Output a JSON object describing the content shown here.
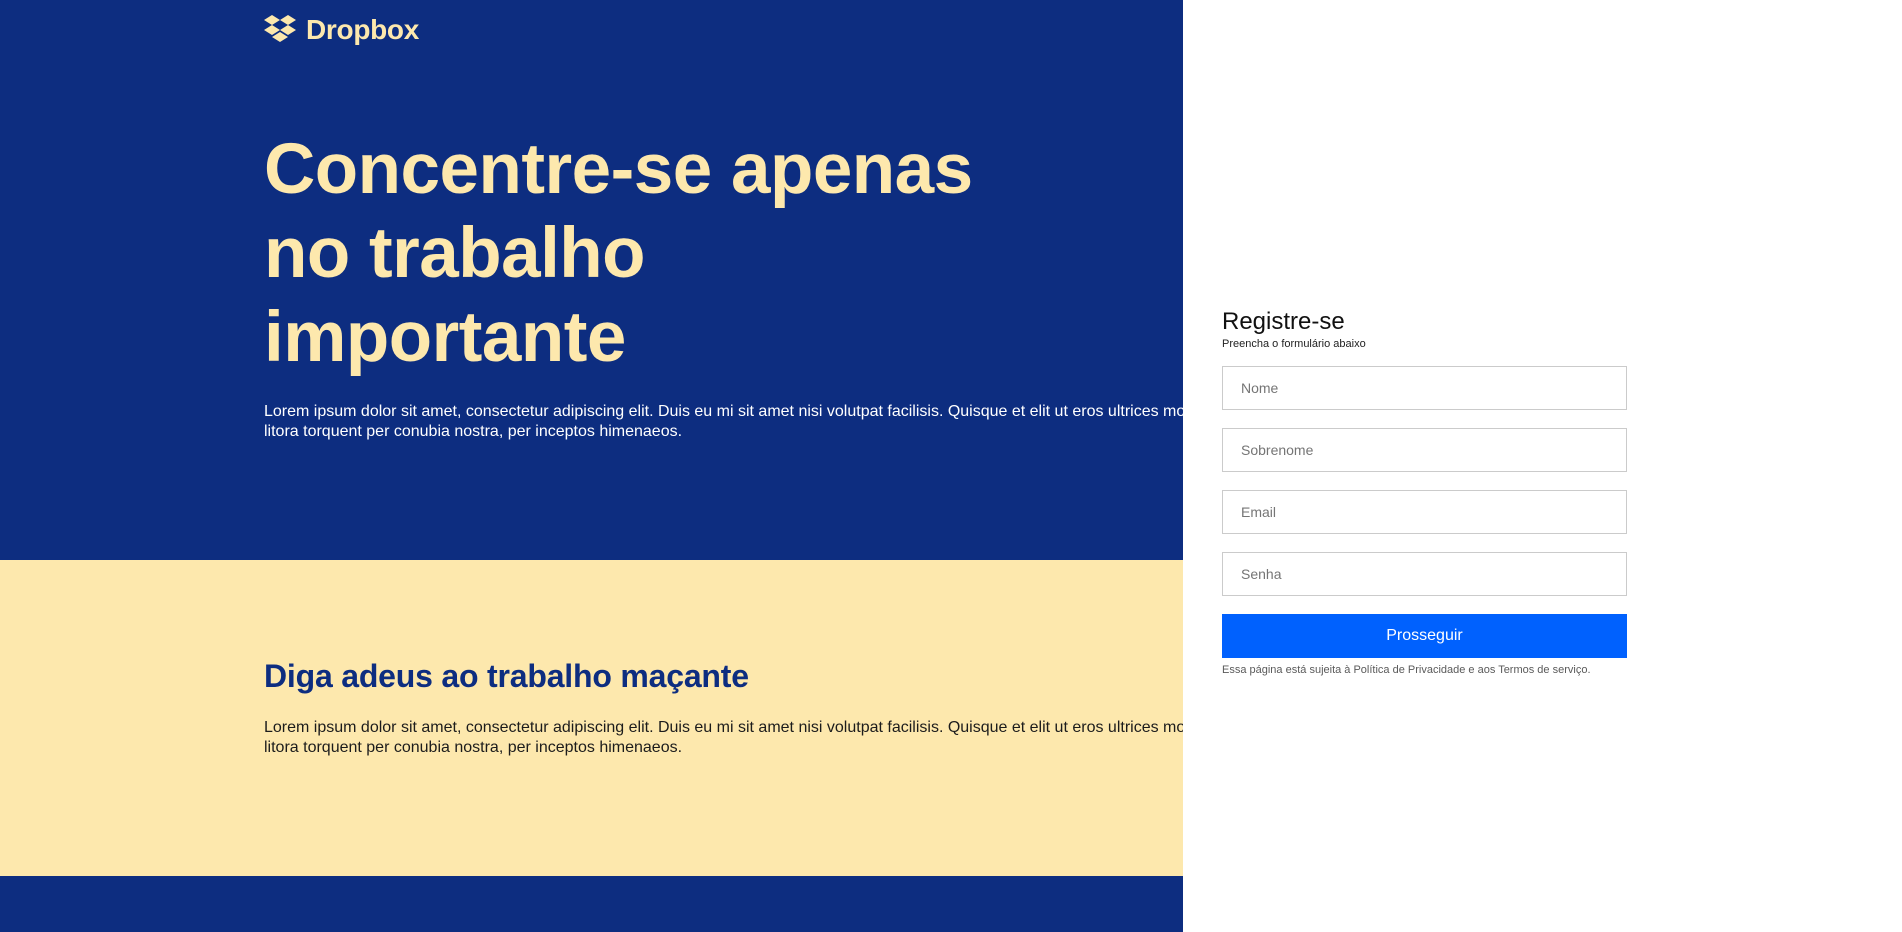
{
  "brand": {
    "name": "Dropbox",
    "logo_icon": "dropbox-box-icon",
    "colors": {
      "navy": "#0d2d80",
      "cream": "#fde8ad",
      "button_blue": "#0061fe"
    }
  },
  "hero": {
    "title_line1": "Concentre-se apenas",
    "title_line2": "no trabalho",
    "title_line3": "importante",
    "text": "Lorem ipsum dolor sit amet, consectetur adipiscing elit. Duis eu mi sit amet nisi volutpat facilisis. Quisque et elit ut eros ultrices mo\nlitora torquent per conubia nostra, per inceptos himenaeos."
  },
  "section": {
    "title": "Diga adeus ao trabalho maçante",
    "text": "Lorem ipsum dolor sit amet, consectetur adipiscing elit. Duis eu mi sit amet nisi volutpat facilisis. Quisque et elit ut eros ultrices mo\nlitora torquent per conubia nostra, per inceptos himenaeos."
  },
  "signup": {
    "title": "Registre-se",
    "subtitle": "Preencha o formulário abaixo",
    "fields": {
      "first_name_placeholder": "Nome",
      "last_name_placeholder": "Sobrenome",
      "email_placeholder": "Email",
      "password_placeholder": "Senha"
    },
    "submit_label": "Prosseguir",
    "legal": "Essa página está sujeita à Política de Privacidade e aos Termos de serviço."
  }
}
